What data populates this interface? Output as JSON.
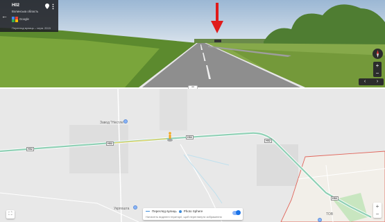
{
  "street_view": {
    "road_name": "H02",
    "region": "Волинська область",
    "provider": "Google",
    "credit": "Перегляд вулиць – черв. 2015",
    "back_icon": "arrow-left-icon",
    "zoom_in": "+",
    "zoom_out": "−",
    "nav_prev": "‹",
    "nav_next": "›",
    "sky_color": "#a8c3df",
    "field_color": "#6f9a3a",
    "road_color": "#8e8e8e",
    "annotation_arrow_color": "#e01b1b"
  },
  "divider": {
    "handle_label": "═"
  },
  "map": {
    "labels": {
      "place_top": "Завод \"Нестле\"",
      "place_bottom": "Укрпошта",
      "place_br": "ТОВ"
    },
    "road_shields": [
      "H02",
      "H02",
      "H02",
      "H02",
      "H02"
    ],
    "route_color": "#8fd0b5",
    "border_color": "#e0645a",
    "legend": {
      "street_view_label": "Перегляд вулиць",
      "photo_sphere_label": "Photo Sphere",
      "hint": "Натисніть виділені території, щоб переглянути зображення"
    },
    "zoom_in": "+",
    "zoom_out": "−",
    "expand_icon": "expand-icon"
  }
}
